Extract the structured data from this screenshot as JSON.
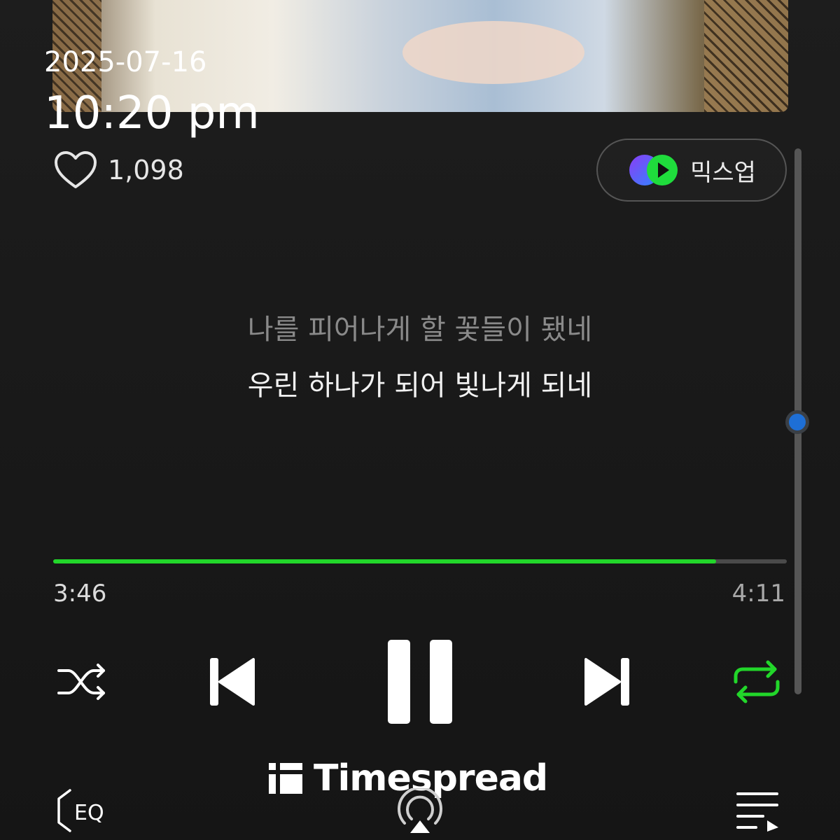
{
  "status": {
    "date": "2025-07-16",
    "time": "10:20 pm"
  },
  "player": {
    "like_count": "1,098",
    "mixup_label": "믹스업",
    "lyrics": {
      "previous": "나를 피어나게 할 꽃들이 됐네",
      "current": "우린 하나가 되어 빛나게 되네"
    },
    "progress": {
      "elapsed": "3:46",
      "total": "4:11",
      "fraction": 0.904
    },
    "repeat_active": true,
    "controls": [
      "shuffle-icon",
      "previous-track-icon",
      "pause-icon",
      "next-track-icon",
      "repeat-icon"
    ],
    "bottom": {
      "eq_label": "EQ",
      "cast_icon": "airplay-icon",
      "playlist_icon": "playlist-icon"
    }
  },
  "watermark": {
    "brand": "Timespread"
  },
  "colors": {
    "accent": "#22d62a",
    "scroll_thumb": "#1e6fd6"
  }
}
